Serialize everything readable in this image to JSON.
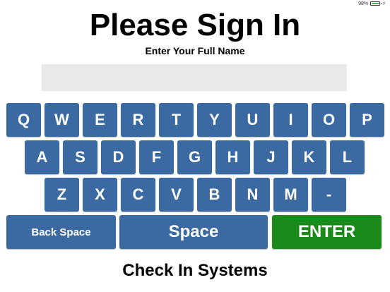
{
  "status": {
    "battery": "98%",
    "battery_level": 0.98
  },
  "header": {
    "title": "Please Sign In",
    "subtitle": "Enter Your Full Name"
  },
  "name_field": {
    "value": "",
    "placeholder": ""
  },
  "keyboard": {
    "row1": [
      "Q",
      "W",
      "E",
      "R",
      "T",
      "Y",
      "U",
      "I",
      "O",
      "P"
    ],
    "row2": [
      "A",
      "S",
      "D",
      "F",
      "G",
      "H",
      "J",
      "K",
      "L"
    ],
    "row3": [
      "Z",
      "X",
      "C",
      "V",
      "B",
      "N",
      "M",
      "-"
    ],
    "backspace_label": "Back Space",
    "space_label": "Space",
    "enter_label": "ENTER"
  },
  "colors": {
    "key": "#3a6aa1",
    "enter": "#1a8a1a",
    "input_bg": "#e9e9e9"
  },
  "footer": {
    "brand": "Check In Systems"
  }
}
